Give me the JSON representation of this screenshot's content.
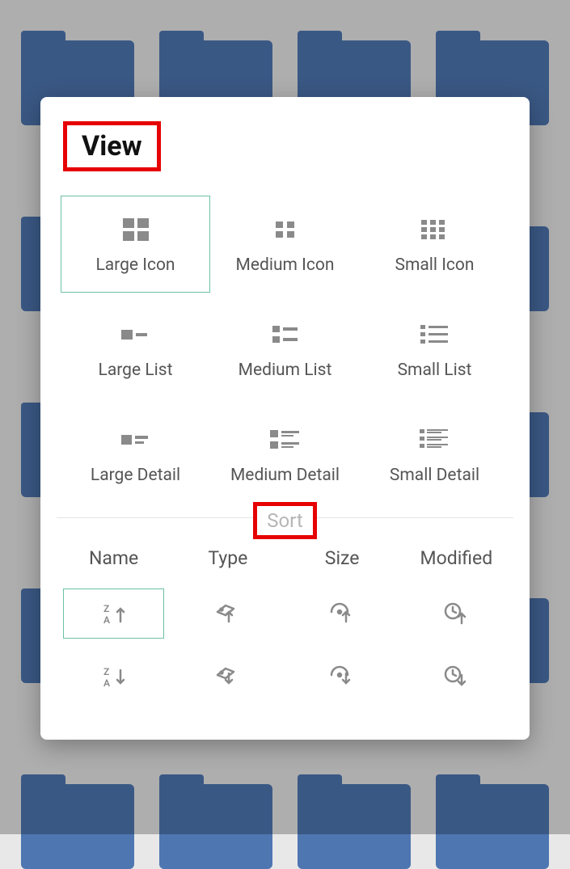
{
  "dialog": {
    "title": "View",
    "viewOptions": [
      {
        "label": "Large Icon",
        "selected": true
      },
      {
        "label": "Medium Icon",
        "selected": false
      },
      {
        "label": "Small Icon",
        "selected": false
      },
      {
        "label": "Large List",
        "selected": false
      },
      {
        "label": "Medium List",
        "selected": false
      },
      {
        "label": "Small List",
        "selected": false
      },
      {
        "label": "Large Detail",
        "selected": false
      },
      {
        "label": "Medium Detail",
        "selected": false
      },
      {
        "label": "Small Detail",
        "selected": false
      }
    ],
    "sortHeader": "Sort",
    "sortColumns": [
      "Name",
      "Type",
      "Size",
      "Modified"
    ],
    "sortAscSelected": 0
  }
}
